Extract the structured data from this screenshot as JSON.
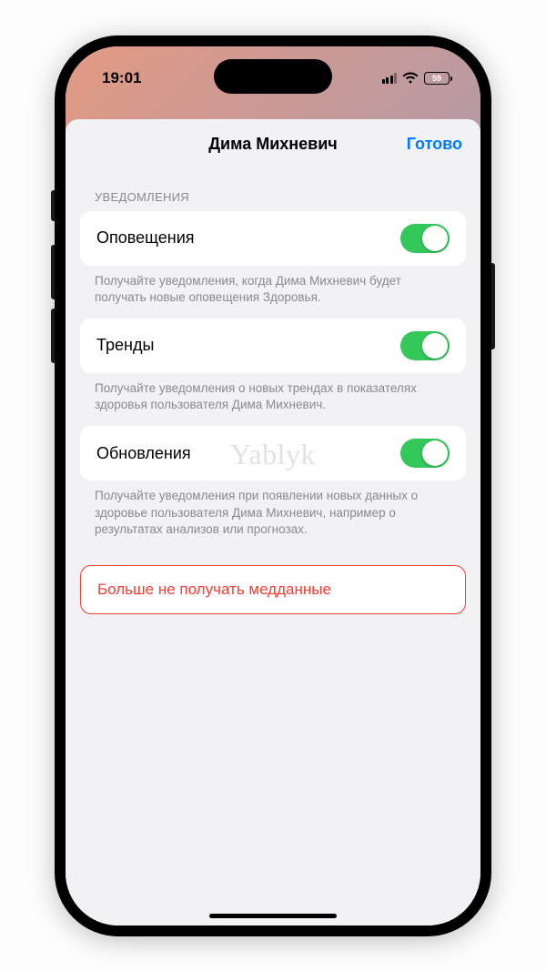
{
  "status": {
    "time": "19:01",
    "battery_pct": "59"
  },
  "sheet": {
    "title": "Дима Михневич",
    "done": "Готово",
    "section_header": "УВЕДОМЛЕНИЯ",
    "rows": [
      {
        "label": "Оповещения",
        "footer": "Получайте уведомления, когда Дима Михневич будет получать новые оповещения Здоровья."
      },
      {
        "label": "Тренды",
        "footer": "Получайте уведомления о новых трендах в показателях здоровья пользователя Дима Михневич."
      },
      {
        "label": "Обновления",
        "footer": "Получайте уведомления при появлении новых данных о здоровье пользователя Дима Михневич, например о результатах анализов или прогнозах."
      }
    ],
    "danger_label": "Больше не получать медданные"
  },
  "watermark": "Yablyk"
}
